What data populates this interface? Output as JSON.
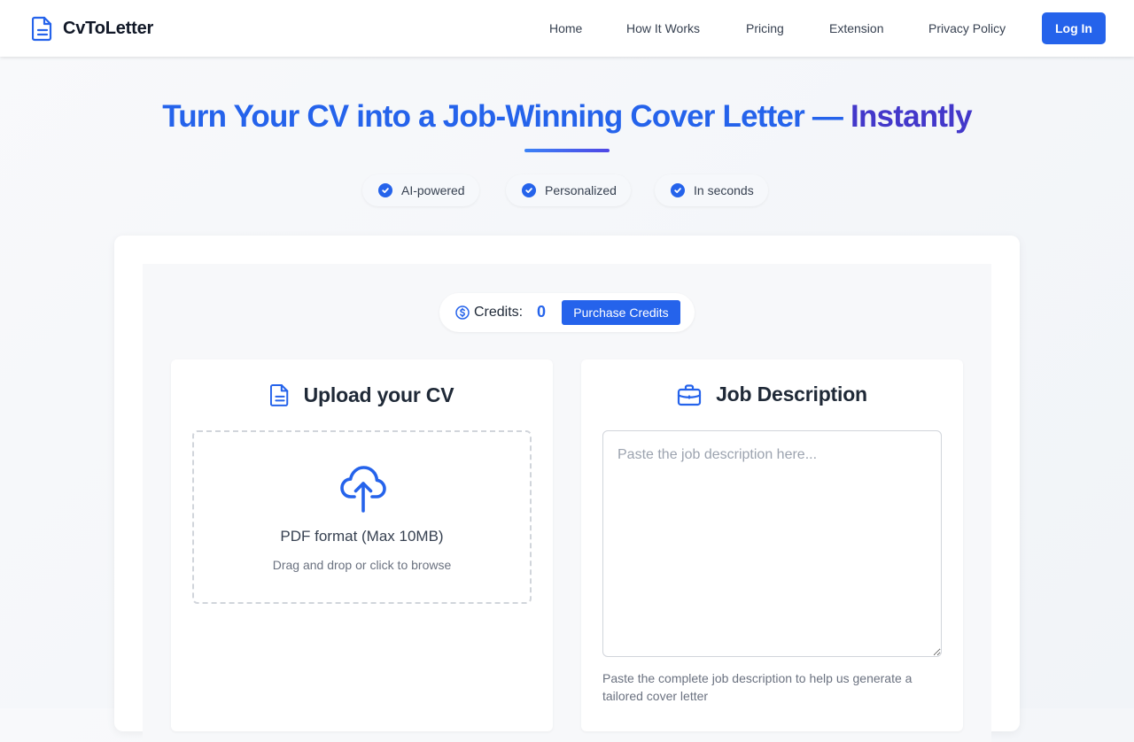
{
  "header": {
    "brand": "CvToLetter",
    "nav": [
      "Home",
      "How It Works",
      "Pricing",
      "Extension",
      "Privacy Policy"
    ],
    "login_label": "Log In"
  },
  "hero": {
    "title_part1": "Turn Your CV into a Job-Winning Cover Letter — ",
    "title_part2": "Instantly",
    "features": [
      "AI-powered",
      "Personalized",
      "In seconds"
    ]
  },
  "credits": {
    "label": "Credits:",
    "value": "0",
    "purchase_label": "Purchase Credits"
  },
  "upload": {
    "title": "Upload your CV",
    "format": "PDF format (Max 10MB)",
    "hint": "Drag and drop or click to browse"
  },
  "job": {
    "title": "Job Description",
    "placeholder": "Paste the job description here...",
    "value": "",
    "hint": "Paste the complete job description to help us generate a tailored cover letter"
  },
  "colors": {
    "accent": "#2563eb",
    "accent_dark": "#4338ca"
  },
  "icons": {
    "brand": "document-icon",
    "credits": "dollar-circle-icon",
    "upload_panel": "document-icon",
    "dropzone": "cloud-upload-icon",
    "job_panel": "briefcase-icon",
    "feature": "check-circle-icon"
  }
}
